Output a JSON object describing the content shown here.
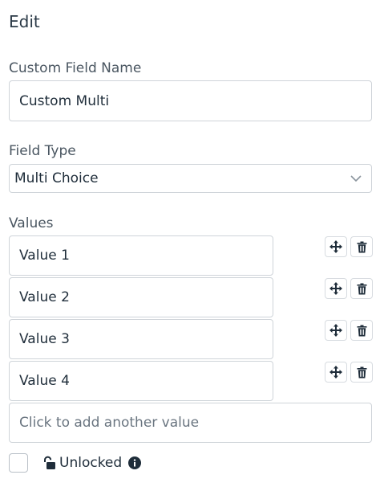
{
  "header": {
    "title": "Edit"
  },
  "custom_field_name": {
    "label": "Custom Field Name",
    "value": "Custom Multi"
  },
  "field_type": {
    "label": "Field Type",
    "selected": "Multi Choice"
  },
  "values_section": {
    "label": "Values",
    "items": [
      {
        "value": "Value 1"
      },
      {
        "value": "Value 2"
      },
      {
        "value": "Value 3"
      },
      {
        "value": "Value 4"
      }
    ],
    "add_placeholder": "Click to add another value"
  },
  "lock": {
    "label": "Unlocked"
  },
  "icons": {
    "move": "move-icon",
    "delete": "trash-icon",
    "lock": "unlocked-padlock-icon",
    "info": "info-icon",
    "dropdown": "chevron-down-icon"
  }
}
